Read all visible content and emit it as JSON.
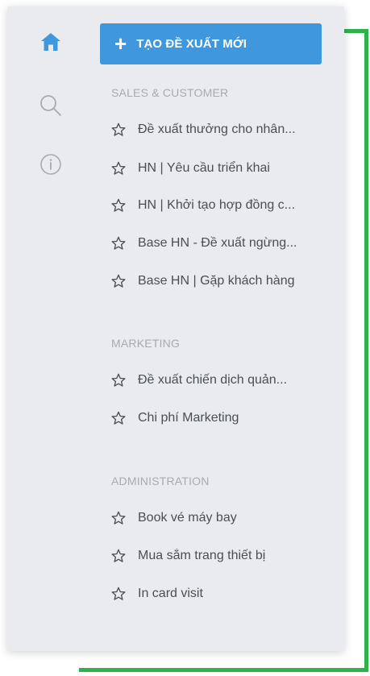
{
  "rail": {
    "icons": [
      "home-icon",
      "search-icon",
      "info-icon"
    ]
  },
  "create_button": {
    "label": "TẠO ĐỀ XUẤT MỚI",
    "icon": "plus-icon"
  },
  "sections": [
    {
      "title": "SALES & CUSTOMER",
      "items": [
        {
          "label": "Đề xuất thưởng cho nhân..."
        },
        {
          "label": "HN | Yêu cầu triển khai"
        },
        {
          "label": "HN | Khởi tạo hợp đồng c..."
        },
        {
          "label": "Base HN - Đề xuất ngừng..."
        },
        {
          "label": "Base HN | Gặp khách hàng"
        }
      ]
    },
    {
      "title": "MARKETING",
      "items": [
        {
          "label": "Đề xuất chiến dịch quản..."
        },
        {
          "label": "Chi phí Marketing"
        }
      ]
    },
    {
      "title": "ADMINISTRATION",
      "items": [
        {
          "label": "Book vé máy bay"
        },
        {
          "label": "Mua sắm trang thiết bị"
        },
        {
          "label": "In card visit"
        }
      ]
    }
  ],
  "colors": {
    "accent": "#3f97de",
    "bracket": "#2db34a",
    "panel_bg": "#e9ebee",
    "section_title": "#a7abb1",
    "item_text": "#4a4f56"
  }
}
